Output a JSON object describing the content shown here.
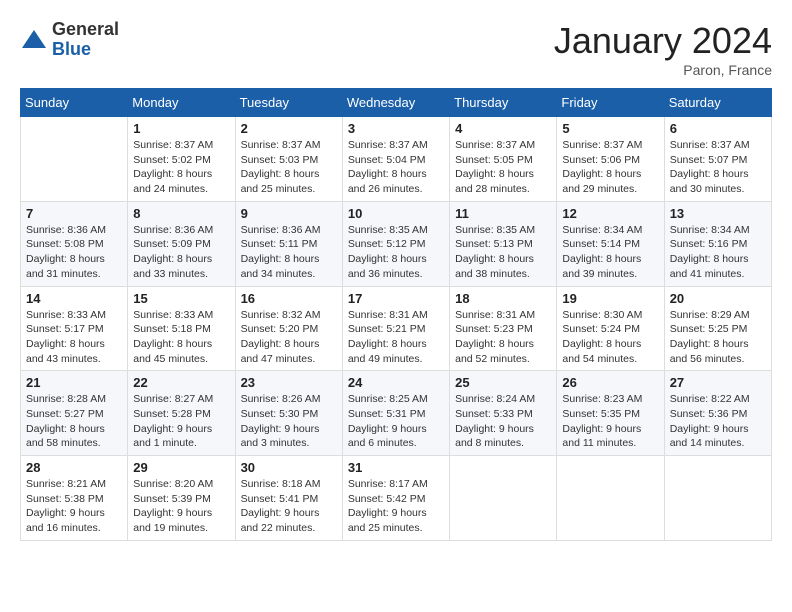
{
  "header": {
    "logo_general": "General",
    "logo_blue": "Blue",
    "month_title": "January 2024",
    "location": "Paron, France"
  },
  "days_of_week": [
    "Sunday",
    "Monday",
    "Tuesday",
    "Wednesday",
    "Thursday",
    "Friday",
    "Saturday"
  ],
  "weeks": [
    [
      {
        "day": "",
        "info": ""
      },
      {
        "day": "1",
        "info": "Sunrise: 8:37 AM\nSunset: 5:02 PM\nDaylight: 8 hours\nand 24 minutes."
      },
      {
        "day": "2",
        "info": "Sunrise: 8:37 AM\nSunset: 5:03 PM\nDaylight: 8 hours\nand 25 minutes."
      },
      {
        "day": "3",
        "info": "Sunrise: 8:37 AM\nSunset: 5:04 PM\nDaylight: 8 hours\nand 26 minutes."
      },
      {
        "day": "4",
        "info": "Sunrise: 8:37 AM\nSunset: 5:05 PM\nDaylight: 8 hours\nand 28 minutes."
      },
      {
        "day": "5",
        "info": "Sunrise: 8:37 AM\nSunset: 5:06 PM\nDaylight: 8 hours\nand 29 minutes."
      },
      {
        "day": "6",
        "info": "Sunrise: 8:37 AM\nSunset: 5:07 PM\nDaylight: 8 hours\nand 30 minutes."
      }
    ],
    [
      {
        "day": "7",
        "info": "Daylight: 8 hours\nand 31 minutes."
      },
      {
        "day": "8",
        "info": "Sunrise: 8:36 AM\nSunset: 5:09 PM\nDaylight: 8 hours\nand 33 minutes."
      },
      {
        "day": "9",
        "info": "Sunrise: 8:36 AM\nSunset: 5:11 PM\nDaylight: 8 hours\nand 34 minutes."
      },
      {
        "day": "10",
        "info": "Sunrise: 8:35 AM\nSunset: 5:12 PM\nDaylight: 8 hours\nand 36 minutes."
      },
      {
        "day": "11",
        "info": "Sunrise: 8:35 AM\nSunset: 5:13 PM\nDaylight: 8 hours\nand 38 minutes."
      },
      {
        "day": "12",
        "info": "Sunrise: 8:34 AM\nSunset: 5:14 PM\nDaylight: 8 hours\nand 39 minutes."
      },
      {
        "day": "13",
        "info": "Sunrise: 8:34 AM\nSunset: 5:16 PM\nDaylight: 8 hours\nand 41 minutes."
      }
    ],
    [
      {
        "day": "14",
        "info": "Sunrise: 8:33 AM\nSunset: 5:17 PM\nDaylight: 8 hours\nand 43 minutes."
      },
      {
        "day": "15",
        "info": "Sunrise: 8:33 AM\nSunset: 5:18 PM\nDaylight: 8 hours\nand 45 minutes."
      },
      {
        "day": "16",
        "info": "Sunrise: 8:32 AM\nSunset: 5:20 PM\nDaylight: 8 hours\nand 47 minutes."
      },
      {
        "day": "17",
        "info": "Sunrise: 8:31 AM\nSunset: 5:21 PM\nDaylight: 8 hours\nand 49 minutes."
      },
      {
        "day": "18",
        "info": "Sunrise: 8:31 AM\nSunset: 5:23 PM\nDaylight: 8 hours\nand 52 minutes."
      },
      {
        "day": "19",
        "info": "Sunrise: 8:30 AM\nSunset: 5:24 PM\nDaylight: 8 hours\nand 54 minutes."
      },
      {
        "day": "20",
        "info": "Sunrise: 8:29 AM\nSunset: 5:25 PM\nDaylight: 8 hours\nand 56 minutes."
      }
    ],
    [
      {
        "day": "21",
        "info": "Sunrise: 8:28 AM\nSunset: 5:27 PM\nDaylight: 8 hours\nand 58 minutes."
      },
      {
        "day": "22",
        "info": "Sunrise: 8:27 AM\nSunset: 5:28 PM\nDaylight: 9 hours\nand 1 minute."
      },
      {
        "day": "23",
        "info": "Sunrise: 8:26 AM\nSunset: 5:30 PM\nDaylight: 9 hours\nand 3 minutes."
      },
      {
        "day": "24",
        "info": "Sunrise: 8:25 AM\nSunset: 5:31 PM\nDaylight: 9 hours\nand 6 minutes."
      },
      {
        "day": "25",
        "info": "Sunrise: 8:24 AM\nSunset: 5:33 PM\nDaylight: 9 hours\nand 8 minutes."
      },
      {
        "day": "26",
        "info": "Sunrise: 8:23 AM\nSunset: 5:35 PM\nDaylight: 9 hours\nand 11 minutes."
      },
      {
        "day": "27",
        "info": "Sunrise: 8:22 AM\nSunset: 5:36 PM\nDaylight: 9 hours\nand 14 minutes."
      }
    ],
    [
      {
        "day": "28",
        "info": "Sunrise: 8:21 AM\nSunset: 5:38 PM\nDaylight: 9 hours\nand 16 minutes."
      },
      {
        "day": "29",
        "info": "Sunrise: 8:20 AM\nSunset: 5:39 PM\nDaylight: 9 hours\nand 19 minutes."
      },
      {
        "day": "30",
        "info": "Sunrise: 8:18 AM\nSunset: 5:41 PM\nDaylight: 9 hours\nand 22 minutes."
      },
      {
        "day": "31",
        "info": "Sunrise: 8:17 AM\nSunset: 5:42 PM\nDaylight: 9 hours\nand 25 minutes."
      },
      {
        "day": "",
        "info": ""
      },
      {
        "day": "",
        "info": ""
      },
      {
        "day": "",
        "info": ""
      }
    ]
  ],
  "week7_sunday": "Sunrise: 8:36 AM\nSunset: 5:08 PM"
}
